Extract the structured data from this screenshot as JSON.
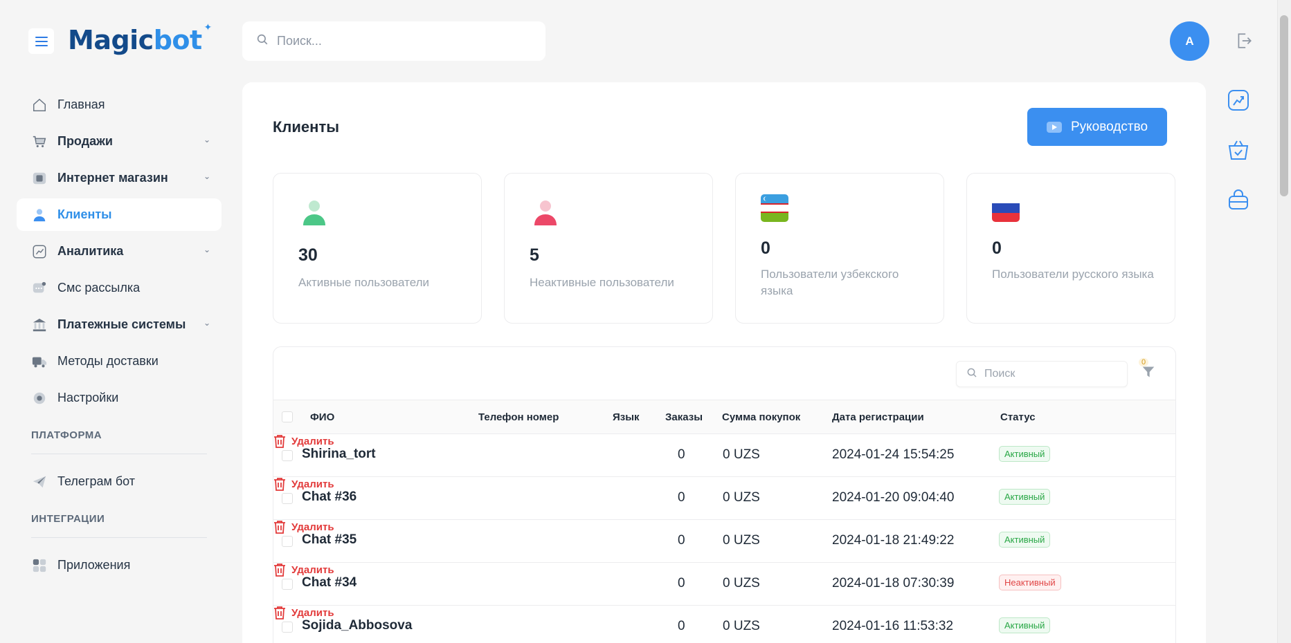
{
  "brand": {
    "logo_a": "Magic",
    "logo_b": "bot"
  },
  "topbar": {
    "search_placeholder": "Поиск...",
    "avatar_initial": "A"
  },
  "sidebar": {
    "items": [
      {
        "label": "Главная",
        "icon": "home-icon"
      },
      {
        "label": "Продажи",
        "icon": "cart-icon",
        "expandable": true
      },
      {
        "label": "Интернет магазин",
        "icon": "store-icon",
        "expandable": true
      },
      {
        "label": "Клиенты",
        "icon": "user-icon",
        "active": true
      },
      {
        "label": "Аналитика",
        "icon": "analytics-icon",
        "expandable": true
      },
      {
        "label": "Смс рассылка",
        "icon": "sms-icon"
      },
      {
        "label": "Платежные системы",
        "icon": "bank-icon",
        "expandable": true
      },
      {
        "label": "Методы доставки",
        "icon": "truck-icon"
      },
      {
        "label": "Настройки",
        "icon": "gear-icon"
      }
    ],
    "platform_label": "ПЛАТФОРМА",
    "platform_items": [
      {
        "label": "Телеграм бот",
        "icon": "telegram-icon"
      }
    ],
    "integrations_label": "ИНТЕГРАЦИИ",
    "integration_items": [
      {
        "label": "Приложения",
        "icon": "apps-icon"
      }
    ]
  },
  "main": {
    "title": "Клиенты",
    "guide_button": "Руководство",
    "cards": [
      {
        "value": "30",
        "label": "Активные пользователи",
        "icon": "user-green-icon"
      },
      {
        "value": "5",
        "label": "Неактивные пользователи",
        "icon": "user-red-icon"
      },
      {
        "value": "0",
        "label": "Пользователи узбекского языка",
        "icon": "uzbek-flag-icon"
      },
      {
        "value": "0",
        "label": "Пользователи русского языка",
        "icon": "russian-flag-icon"
      }
    ],
    "table": {
      "search_placeholder": "Поиск",
      "filter_count": "0",
      "columns": [
        "ФИО",
        "Телефон номер",
        "Язык",
        "Заказы",
        "Сумма покупок",
        "Дата регистрации",
        "Статус"
      ],
      "delete_label": "Удалить",
      "rows": [
        {
          "name": "Shirina_tort",
          "orders": "0",
          "sum": "0 UZS",
          "date": "2024-01-24 15:54:25",
          "status": "Активный",
          "active": true
        },
        {
          "name": "Chat #36",
          "orders": "0",
          "sum": "0 UZS",
          "date": "2024-01-20 09:04:40",
          "status": "Активный",
          "active": true
        },
        {
          "name": "Chat #35",
          "orders": "0",
          "sum": "0 UZS",
          "date": "2024-01-18 21:49:22",
          "status": "Активный",
          "active": true
        },
        {
          "name": "Chat #34",
          "orders": "0",
          "sum": "0 UZS",
          "date": "2024-01-18 07:30:39",
          "status": "Неактивный",
          "active": false
        },
        {
          "name": "Sojida_Abbosova",
          "orders": "0",
          "sum": "0 UZS",
          "date": "2024-01-16 11:53:32",
          "status": "Активный",
          "active": true
        }
      ]
    }
  },
  "colors": {
    "accent": "#3b8ff0",
    "active_status": "#28a745",
    "inactive_status": "#e04545"
  }
}
